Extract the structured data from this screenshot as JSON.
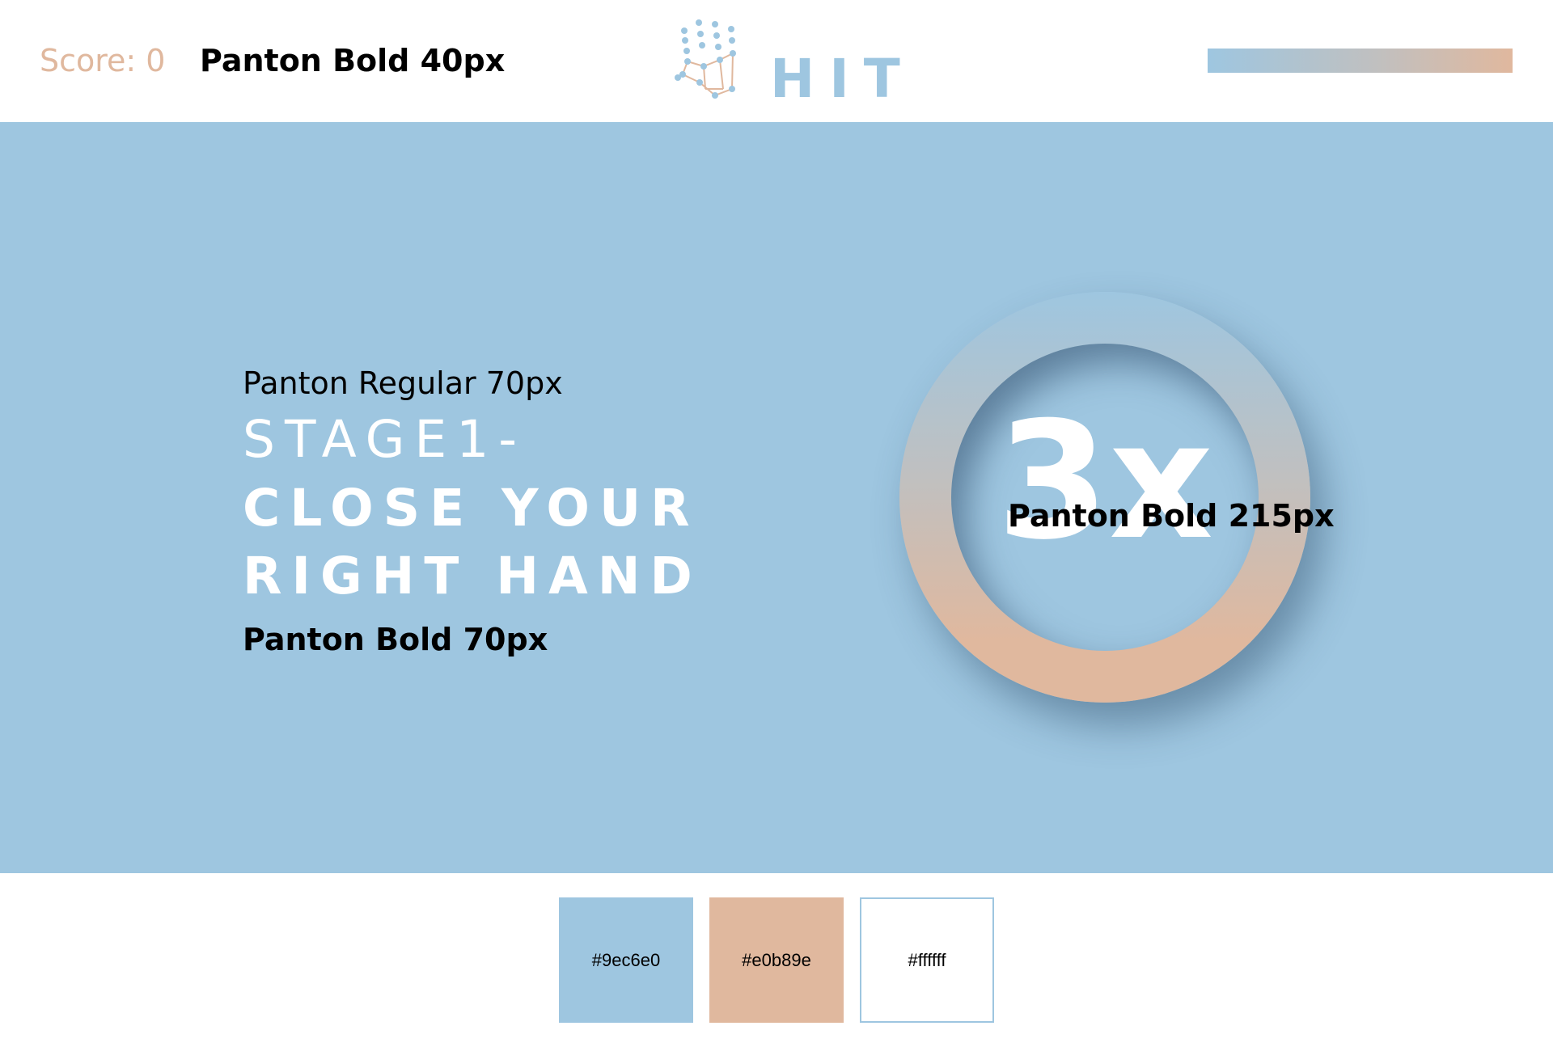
{
  "header": {
    "score_label": "Score: 0",
    "score_annotation": "Panton Bold 40px",
    "logo_text": "HIT",
    "logo_icon": "hand-skeleton-icon",
    "progress_fraction": 1.0
  },
  "stage": {
    "annotation_regular": "Panton Regular 70px",
    "line1": "STAGE1-",
    "line2": "CLOSE YOUR",
    "line3": "RIGHT HAND",
    "annotation_bold": "Panton Bold 70px",
    "countdown": "3x",
    "countdown_annotation": "Panton Bold 215px"
  },
  "palette": {
    "swatches": [
      {
        "label": "#9ec6e0",
        "color": "#9ec6e0"
      },
      {
        "label": "#e0b89e",
        "color": "#e0b89e"
      },
      {
        "label": "#ffffff",
        "color": "#ffffff"
      }
    ]
  }
}
